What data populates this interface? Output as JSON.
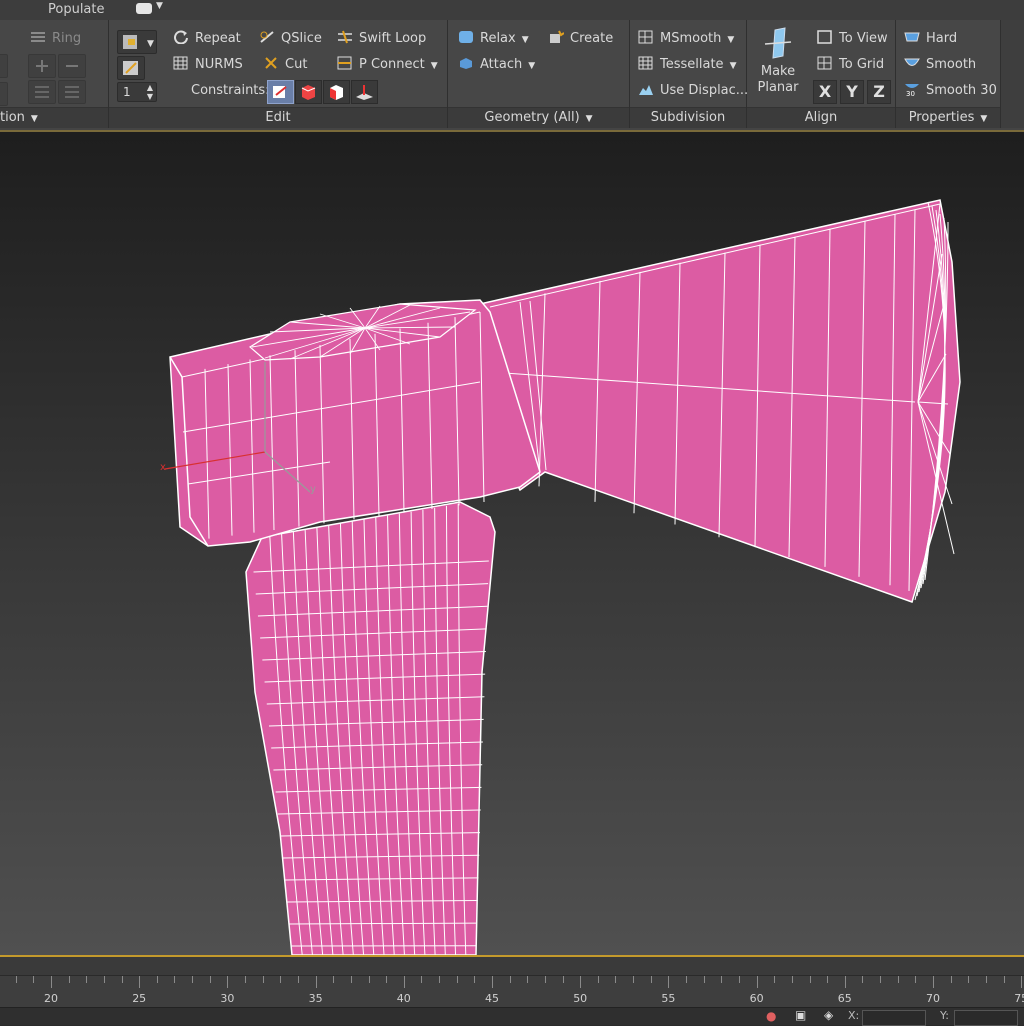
{
  "topbar": {
    "populate_label": "Populate"
  },
  "ribbon": {
    "panels": {
      "selection": {
        "title": "tion"
      },
      "loops": {
        "ring_label": "Ring",
        "spinner_value": "1"
      },
      "edit": {
        "title": "Edit",
        "repeat": "Repeat",
        "qslice": "QSlice",
        "swift_loop": "Swift Loop",
        "nurms": "NURMS",
        "cut": "Cut",
        "p_connect": "P Connect",
        "constraints_label": "Constraints:"
      },
      "geometry": {
        "title": "Geometry (All)",
        "relax": "Relax",
        "create": "Create",
        "attach": "Attach"
      },
      "subdivision": {
        "title": "Subdivision",
        "msmooth": "MSmooth",
        "tessellate": "Tessellate",
        "use_displace": "Use Displac..."
      },
      "align": {
        "title": "Align",
        "make_planar": "Make Planar",
        "to_view": "To View",
        "to_grid": "To Grid",
        "x": "X",
        "y": "Y",
        "z": "Z"
      },
      "properties": {
        "title": "Properties",
        "hard": "Hard",
        "smooth": "Smooth",
        "smooth30": "Smooth 30"
      }
    }
  },
  "viewport": {
    "mesh_color": "#dc5ca3",
    "wire_color": "#ffffff",
    "axis_x_label": "x",
    "axis_y_label": "y"
  },
  "timeline": {
    "ticks": [
      "20",
      "25",
      "30",
      "35",
      "40",
      "45",
      "50",
      "55",
      "60",
      "65",
      "70",
      "75"
    ]
  },
  "statusbar": {
    "x_label": "X:",
    "y_label": "Y:"
  }
}
